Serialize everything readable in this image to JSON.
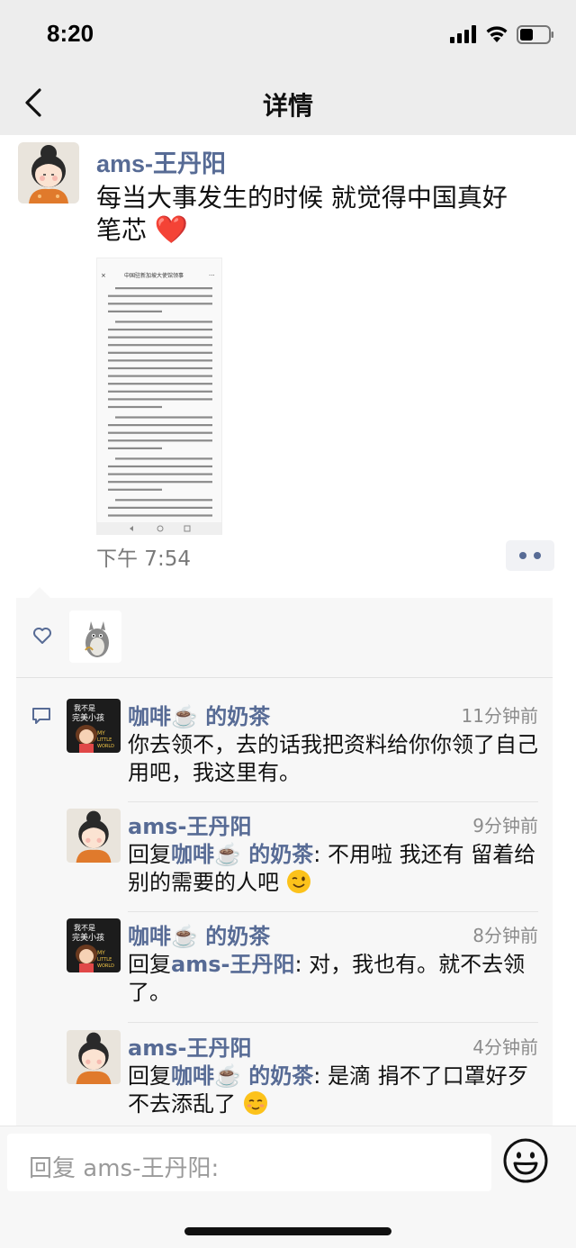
{
  "status_bar": {
    "time": "8:20",
    "icons": [
      "signal-icon",
      "wifi-icon",
      "battery-icon"
    ]
  },
  "nav": {
    "title": "详情",
    "back_icon": "chevron-left-icon"
  },
  "post": {
    "author": "ams-王丹阳",
    "text_line1": "每当大事发生的时候 就觉得中国真好",
    "text_line2": "笔芯",
    "heart": "❤️",
    "image_title": "中国驻新加坡大使馆领事",
    "time": "下午 7:54",
    "more_icon": "more-dots-icon"
  },
  "likes": {
    "icon": "heart-outline-icon"
  },
  "comments": [
    {
      "author": "咖啡☕️ 的奶茶",
      "time": "11分钟前",
      "reply_word": "",
      "reply_to": "",
      "body": "你去领不，去的话我把资料给你你领了自己用吧，我这里有。"
    },
    {
      "author": "ams-王丹阳",
      "time": "9分钟前",
      "reply_word": "回复",
      "reply_to": "咖啡☕️ 的奶茶",
      "body": ": 不用啦 我还有 留着给别的需要的人吧"
    },
    {
      "author": "咖啡☕️ 的奶茶",
      "time": "8分钟前",
      "reply_word": "回复",
      "reply_to": "ams-王丹阳",
      "body": ": 对，我也有。就不去领了。"
    },
    {
      "author": "ams-王丹阳",
      "time": "4分钟前",
      "reply_word": "回复",
      "reply_to": "咖啡☕️ 的奶茶",
      "body": ": 是滴 捐不了口罩好歹不去添乱了"
    }
  ],
  "reply_bar": {
    "placeholder": "回复 ams-王丹阳:",
    "emoji_icon": "smiley-icon"
  }
}
